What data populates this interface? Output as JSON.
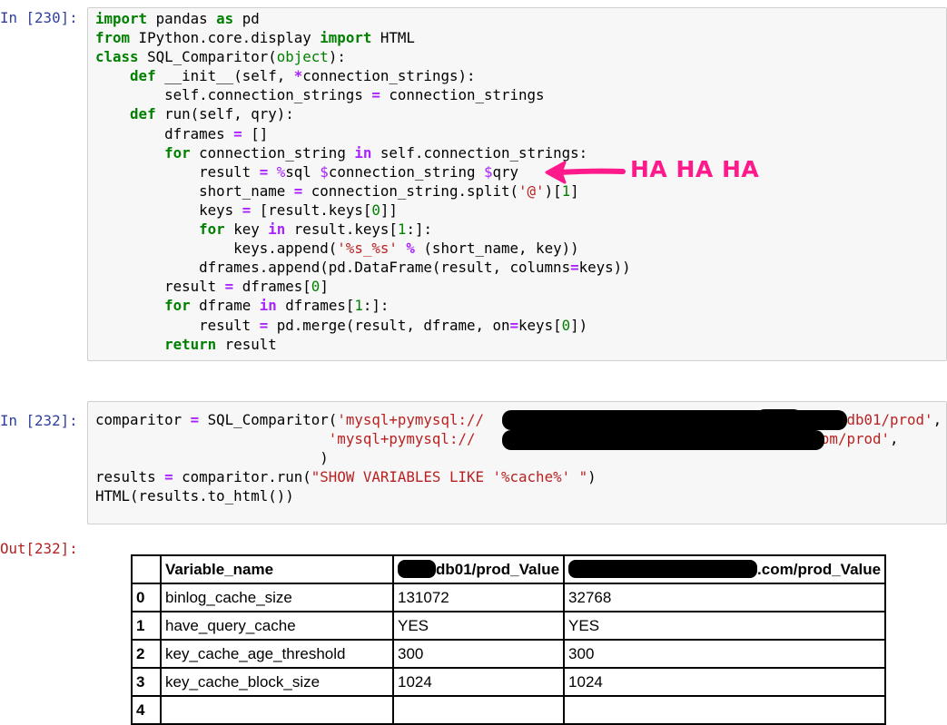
{
  "cells": [
    {
      "prompt": "In [230]:",
      "code_lines": [
        "import pandas as pd",
        "from IPython.core.display import HTML",
        "class SQL_Comparitor(object):",
        "    def __init__(self, *connection_strings):",
        "        self.connection_strings = connection_strings",
        "    def run(self, qry):",
        "        dframes = []",
        "        for connection_string in self.connection_strings:",
        "            result = %sql $connection_string $qry",
        "            short_name = connection_string.split('@')[1]",
        "            keys = [result.keys[0]]",
        "            for key in result.keys[1:]:",
        "                keys.append('%s_%s' % (short_name, key))",
        "            dframes.append(pd.DataFrame(result, columns=keys))",
        "        result = dframes[0]",
        "        for dframe in dframes[1:]:",
        "            result = pd.merge(result, dframe, on=keys[0])",
        "        return result"
      ]
    },
    {
      "prompt": "In [232]:",
      "code_lines": [
        "comparitor = SQL_Comparitor('mysql+pymysql://",
        "@db01/prod',",
        "'mysql+pymysql://",
        "com/prod',",
        ")",
        "results = comparitor.run(\"SHOW VARIABLES LIKE '%cache%' \")",
        "HTML(results.to_html())"
      ]
    }
  ],
  "annotation": "HA HA HA",
  "output": {
    "prompt": "Out[232]:",
    "columns": [
      "Variable_name",
      "db01/prod_Value",
      ".com/prod_Value"
    ],
    "rows": [
      {
        "index": "0",
        "name": "binlog_cache_size",
        "v1": "131072",
        "v2": "32768"
      },
      {
        "index": "1",
        "name": "have_query_cache",
        "v1": "YES",
        "v2": "YES"
      },
      {
        "index": "2",
        "name": "key_cache_age_threshold",
        "v1": "300",
        "v2": "300"
      },
      {
        "index": "3",
        "name": "key_cache_block_size",
        "v1": "1024",
        "v2": "1024"
      },
      {
        "index": "4",
        "name": "",
        "v1": "",
        "v2": ""
      }
    ]
  },
  "colors": {
    "annotation": "#ff1a8c",
    "prompt_in": "#303f9f",
    "prompt_out": "#b22222"
  }
}
